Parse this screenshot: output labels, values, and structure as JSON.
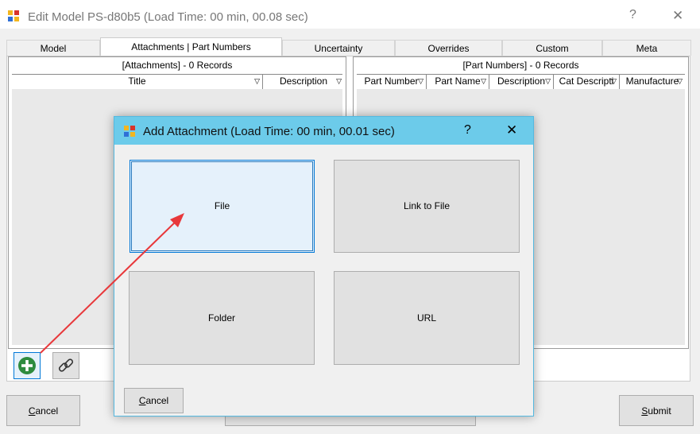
{
  "window": {
    "title": "Edit Model PS-d80b5 (Load Time: 00 min, 00.08 sec)",
    "help_glyph": "?",
    "close_glyph": "✕"
  },
  "tabs": [
    {
      "label": "Model"
    },
    {
      "label": "Attachments | Part Numbers"
    },
    {
      "label": "Uncertainty"
    },
    {
      "label": "Overrides"
    },
    {
      "label": "Custom"
    },
    {
      "label": "Meta"
    }
  ],
  "attachments_grid": {
    "header": "[Attachments] - 0 Records",
    "columns": [
      "Title",
      "Description"
    ]
  },
  "part_numbers_grid": {
    "header": "[Part Numbers] - 0 Records",
    "columns": [
      "Part Number",
      "Part Name",
      "Description",
      "Cat Descripti",
      "Manufacture"
    ]
  },
  "main_buttons": {
    "cancel_underline": "C",
    "cancel_rest": "ancel",
    "submit_underline": "S",
    "submit_rest": "ubmit"
  },
  "dialog": {
    "title": "Add Attachment (Load Time: 00 min, 00.01 sec)",
    "help_glyph": "?",
    "close_glyph": "✕",
    "choices": {
      "file": "File",
      "link_to_file": "Link to File",
      "folder": "Folder",
      "url": "URL"
    },
    "cancel_underline": "C",
    "cancel_rest": "ancel"
  },
  "colors": {
    "dialog_title_bg": "#6ccbea",
    "focus_border": "#0078d7",
    "annotation_arrow": "#e8383b",
    "add_icon_green": "#2e8b3e"
  },
  "icons": {
    "add": "plus-circle-icon",
    "link": "chain-link-icon",
    "app": "app-blocks-icon"
  }
}
